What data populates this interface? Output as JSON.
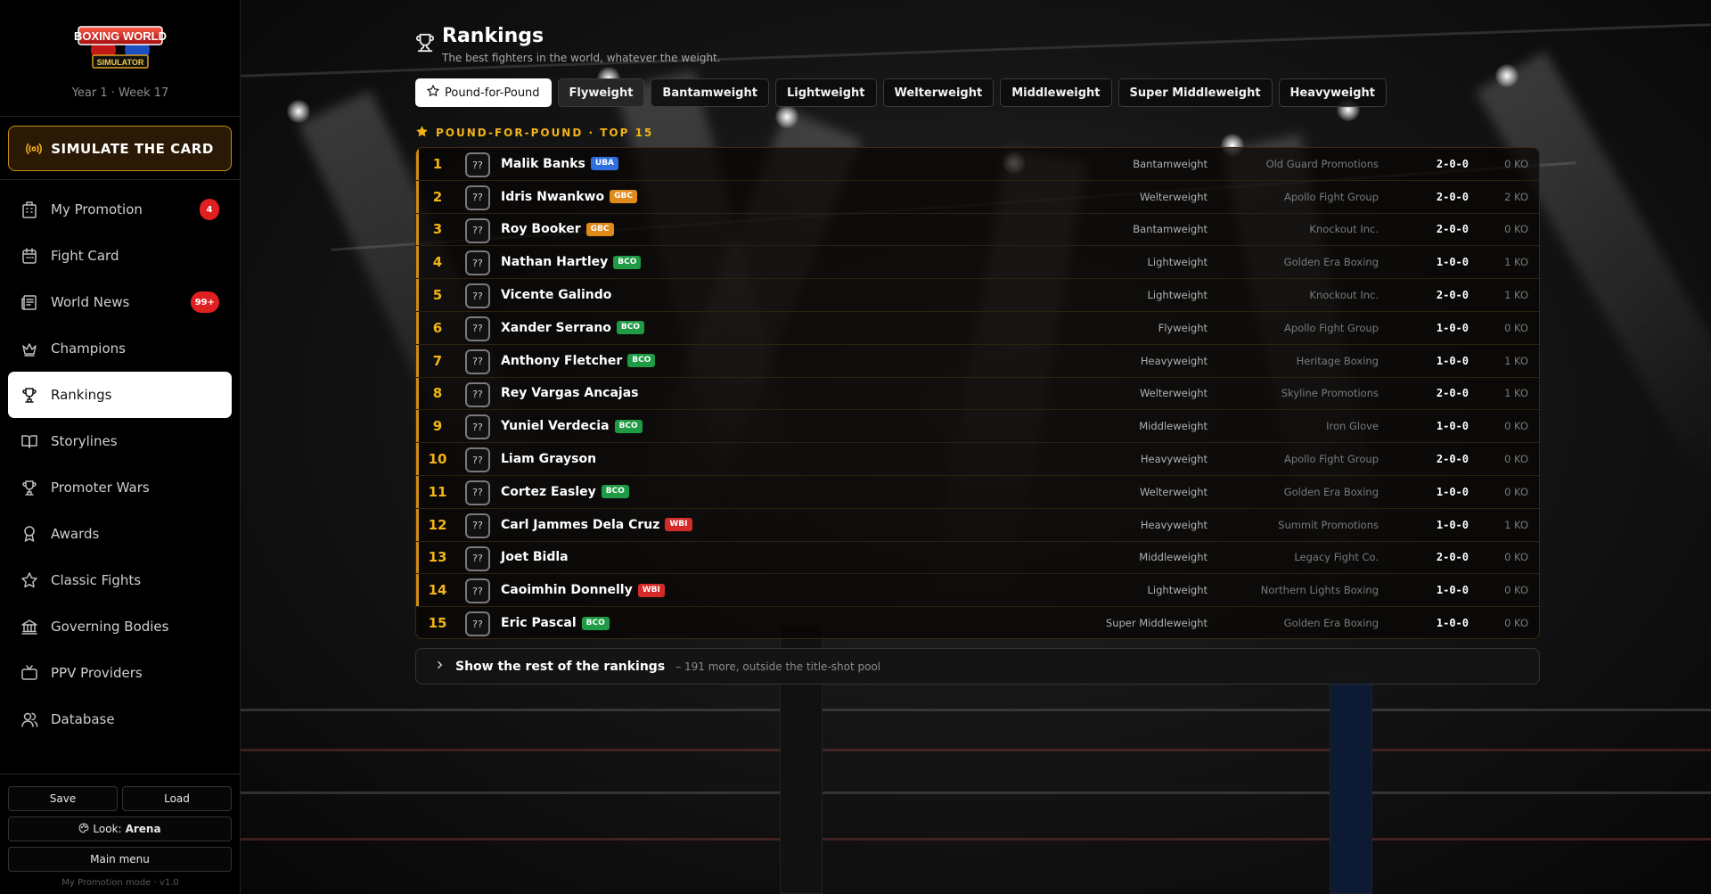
{
  "sidebar": {
    "logo_lines": [
      "BOXING WORLD",
      "SIMULATOR"
    ],
    "week": "Year 1 · Week 17",
    "simulate_label": "SIMULATE THE CARD",
    "items": [
      {
        "label": "My Promotion",
        "icon": "building-icon",
        "badge": "4"
      },
      {
        "label": "Fight Card",
        "icon": "calendar-icon",
        "badge": ""
      },
      {
        "label": "World News",
        "icon": "newspaper-icon",
        "badge": "99+"
      },
      {
        "label": "Champions",
        "icon": "crown-icon",
        "badge": ""
      },
      {
        "label": "Rankings",
        "icon": "trophy-icon",
        "badge": "",
        "active": true
      },
      {
        "label": "Storylines",
        "icon": "book-icon",
        "badge": ""
      },
      {
        "label": "Promoter Wars",
        "icon": "trophy-icon",
        "badge": ""
      },
      {
        "label": "Awards",
        "icon": "award-icon",
        "badge": ""
      },
      {
        "label": "Classic Fights",
        "icon": "star-icon",
        "badge": ""
      },
      {
        "label": "Governing Bodies",
        "icon": "bank-icon",
        "badge": ""
      },
      {
        "label": "PPV Providers",
        "icon": "tv-icon",
        "badge": ""
      },
      {
        "label": "Database",
        "icon": "users-icon",
        "badge": ""
      }
    ],
    "save_label": "Save",
    "load_label": "Load",
    "look_label": "Look:",
    "look_value": "Arena",
    "main_menu_label": "Main menu",
    "version": "My Promotion mode · v1.0"
  },
  "page": {
    "title": "Rankings",
    "subtitle": "The best fighters in the world, whatever the weight.",
    "tabs": [
      "Pound-for-Pound",
      "Flyweight",
      "Bantamweight",
      "Lightweight",
      "Welterweight",
      "Middleweight",
      "Super Middleweight",
      "Heavyweight"
    ],
    "active_tab": "Pound-for-Pound",
    "section_title": "POUND-FOR-POUND · TOP 15",
    "avatar_placeholder": "??",
    "more_label": "Show the rest of the rankings",
    "more_note": "– 191 more, outside the title-shot pool"
  },
  "org_colors": {
    "UBA": "#2f6fe0",
    "GBC": "#e08a1c",
    "BCO": "#1f9a45",
    "WBI": "#d42a2a"
  },
  "rankings": [
    {
      "rank": "1",
      "name": "Malik Banks",
      "org": "UBA",
      "weight": "Bantamweight",
      "promoter": "Old Guard Promotions",
      "record": "2-0-0",
      "ko": "0 KO"
    },
    {
      "rank": "2",
      "name": "Idris Nwankwo",
      "org": "GBC",
      "weight": "Welterweight",
      "promoter": "Apollo Fight Group",
      "record": "2-0-0",
      "ko": "2 KO"
    },
    {
      "rank": "3",
      "name": "Roy Booker",
      "org": "GBC",
      "weight": "Bantamweight",
      "promoter": "Knockout Inc.",
      "record": "2-0-0",
      "ko": "0 KO"
    },
    {
      "rank": "4",
      "name": "Nathan Hartley",
      "org": "BCO",
      "weight": "Lightweight",
      "promoter": "Golden Era Boxing",
      "record": "1-0-0",
      "ko": "1 KO"
    },
    {
      "rank": "5",
      "name": "Vicente Galindo",
      "org": "",
      "weight": "Lightweight",
      "promoter": "Knockout Inc.",
      "record": "2-0-0",
      "ko": "1 KO"
    },
    {
      "rank": "6",
      "name": "Xander Serrano",
      "org": "BCO",
      "weight": "Flyweight",
      "promoter": "Apollo Fight Group",
      "record": "1-0-0",
      "ko": "0 KO"
    },
    {
      "rank": "7",
      "name": "Anthony Fletcher",
      "org": "BCO",
      "weight": "Heavyweight",
      "promoter": "Heritage Boxing",
      "record": "1-0-0",
      "ko": "1 KO"
    },
    {
      "rank": "8",
      "name": "Rey Vargas Ancajas",
      "org": "",
      "weight": "Welterweight",
      "promoter": "Skyline Promotions",
      "record": "2-0-0",
      "ko": "1 KO"
    },
    {
      "rank": "9",
      "name": "Yuniel Verdecia",
      "org": "BCO",
      "weight": "Middleweight",
      "promoter": "Iron Glove",
      "record": "1-0-0",
      "ko": "0 KO"
    },
    {
      "rank": "10",
      "name": "Liam Grayson",
      "org": "",
      "weight": "Heavyweight",
      "promoter": "Apollo Fight Group",
      "record": "2-0-0",
      "ko": "0 KO"
    },
    {
      "rank": "11",
      "name": "Cortez Easley",
      "org": "BCO",
      "weight": "Welterweight",
      "promoter": "Golden Era Boxing",
      "record": "1-0-0",
      "ko": "0 KO"
    },
    {
      "rank": "12",
      "name": "Carl Jammes Dela Cruz",
      "org": "WBI",
      "weight": "Heavyweight",
      "promoter": "Summit Promotions",
      "record": "1-0-0",
      "ko": "1 KO"
    },
    {
      "rank": "13",
      "name": "Joet Bidla",
      "org": "",
      "weight": "Middleweight",
      "promoter": "Legacy Fight Co.",
      "record": "2-0-0",
      "ko": "0 KO"
    },
    {
      "rank": "14",
      "name": "Caoimhin Donnelly",
      "org": "WBI",
      "weight": "Lightweight",
      "promoter": "Northern Lights Boxing",
      "record": "1-0-0",
      "ko": "0 KO"
    },
    {
      "rank": "15",
      "name": "Eric Pascal",
      "org": "BCO",
      "weight": "Super Middleweight",
      "promoter": "Golden Era Boxing",
      "record": "1-0-0",
      "ko": "0 KO"
    }
  ]
}
